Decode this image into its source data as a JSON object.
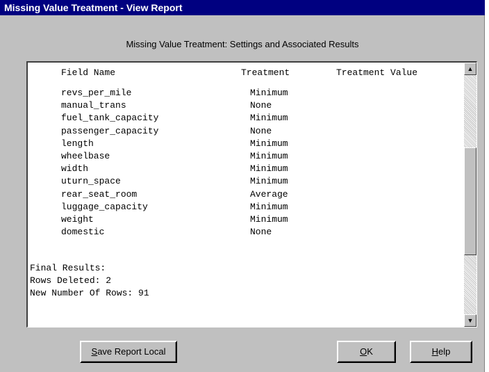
{
  "window": {
    "title": "Missing Value Treatment - View Report"
  },
  "report": {
    "heading": "Missing Value Treatment:  Settings and Associated Results",
    "columns": {
      "field": "Field Name",
      "treatment": "Treatment",
      "value": "Treatment Value"
    },
    "rows": [
      {
        "field": "revs_per_mile",
        "treatment": "Minimum"
      },
      {
        "field": "manual_trans",
        "treatment": "None"
      },
      {
        "field": "fuel_tank_capacity",
        "treatment": "Minimum"
      },
      {
        "field": "passenger_capacity",
        "treatment": "None"
      },
      {
        "field": "length",
        "treatment": "Minimum"
      },
      {
        "field": "wheelbase",
        "treatment": "Minimum"
      },
      {
        "field": "width",
        "treatment": "Minimum"
      },
      {
        "field": "uturn_space",
        "treatment": "Minimum"
      },
      {
        "field": "rear_seat_room",
        "treatment": "Average"
      },
      {
        "field": "luggage_capacity",
        "treatment": "Minimum"
      },
      {
        "field": "weight",
        "treatment": "Minimum"
      },
      {
        "field": "domestic",
        "treatment": "None"
      }
    ],
    "final_results_label": "Final Results:",
    "rows_deleted": "Rows Deleted: 2",
    "new_row_count": "New Number Of Rows: 91"
  },
  "scrollbar": {
    "up_arrow": "▲",
    "down_arrow": "▼",
    "position": 0.55
  },
  "buttons": {
    "save_first": "S",
    "save_rest": "ave Report Local",
    "ok_first": "O",
    "ok_rest": "K",
    "help_first": "H",
    "help_rest": "elp"
  }
}
